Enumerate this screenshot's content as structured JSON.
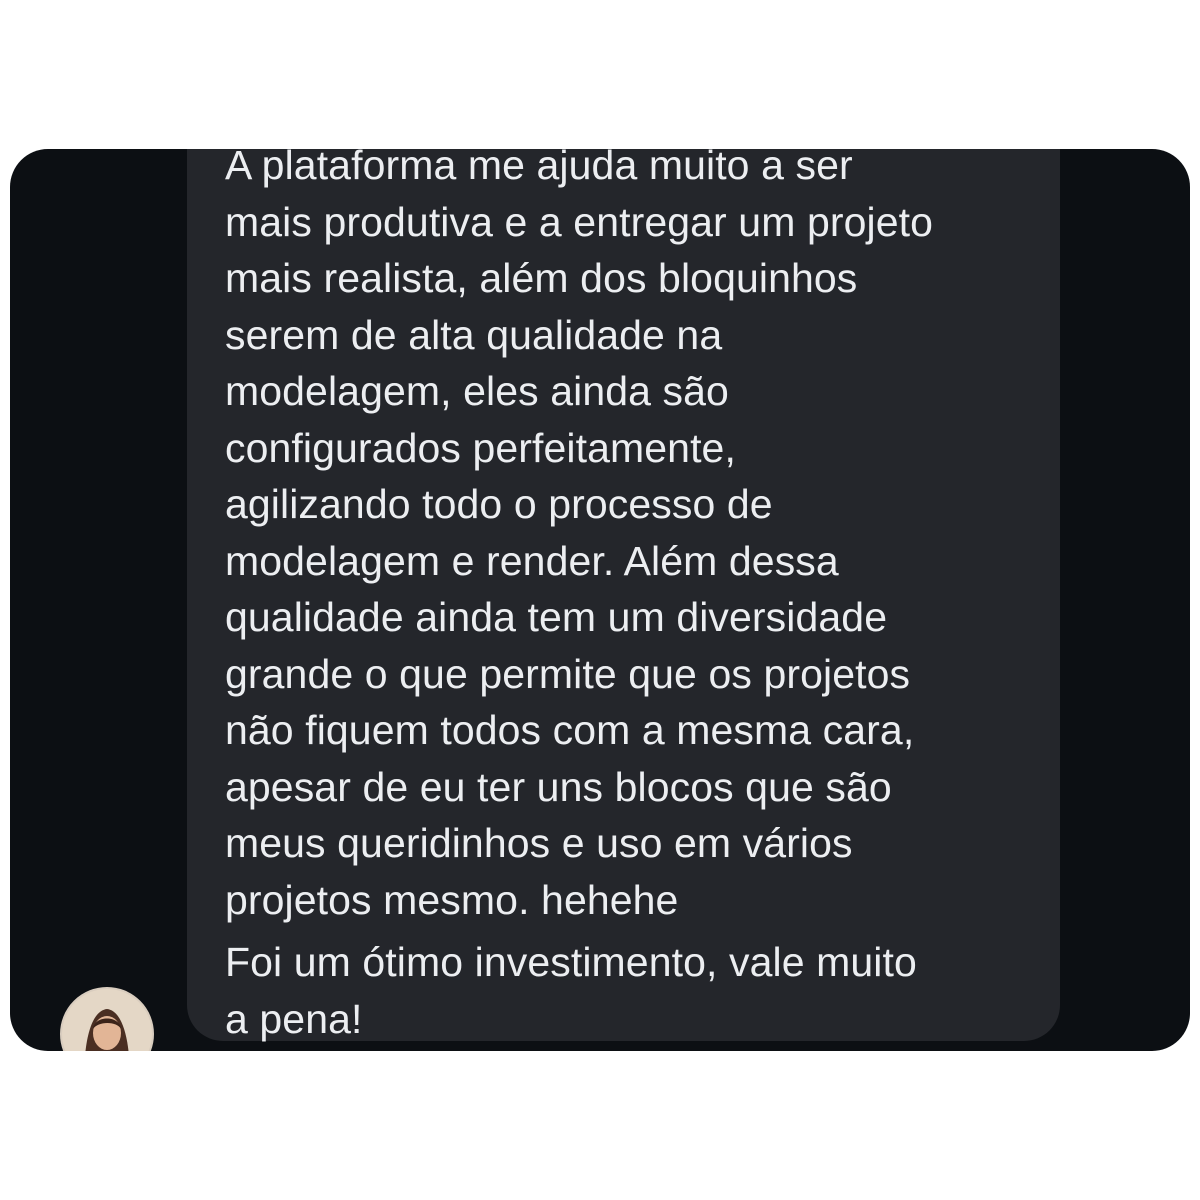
{
  "message": {
    "lines": [
      "A plataforma me ajuda muito a ser",
      "mais produtiva e a entregar um projeto",
      "mais realista, além dos bloquinhos",
      "serem de alta qualidade na",
      "modelagem, eles ainda são",
      "configurados perfeitamente,",
      "agilizando todo o processo de",
      "modelagem e render. Além dessa",
      "qualidade ainda tem um diversidade",
      "grande o que permite que os projetos",
      "não fiquem todos com a mesma cara,",
      "apesar de eu ter uns blocos que são",
      "meus queridinhos e uso em vários",
      "projetos mesmo. hehehe",
      "Foi um ótimo investimento, vale muito",
      "a pena!"
    ]
  },
  "sender": {
    "avatar_icon": "user-avatar-photo"
  },
  "colors": {
    "background": "#0c0f13",
    "bubble": "#24262b",
    "text": "#eceef1"
  }
}
